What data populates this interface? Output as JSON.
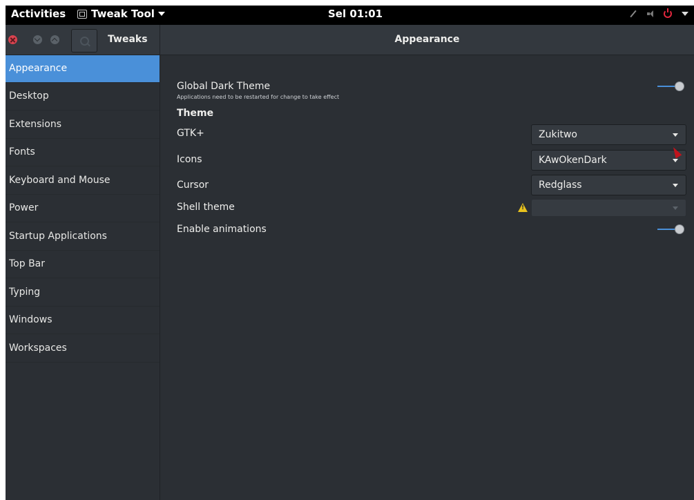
{
  "topbar": {
    "activities": "Activities",
    "app_menu": "Tweak Tool",
    "clock": "Sel 01:01"
  },
  "header": {
    "app_title": "Tweaks",
    "page_title": "Appearance"
  },
  "sidebar": {
    "items": [
      {
        "label": "Appearance"
      },
      {
        "label": "Desktop"
      },
      {
        "label": "Extensions"
      },
      {
        "label": "Fonts"
      },
      {
        "label": "Keyboard and Mouse"
      },
      {
        "label": "Power"
      },
      {
        "label": "Startup Applications"
      },
      {
        "label": "Top Bar"
      },
      {
        "label": "Typing"
      },
      {
        "label": "Windows"
      },
      {
        "label": "Workspaces"
      }
    ],
    "selected": "Appearance"
  },
  "appearance": {
    "global_dark_theme": {
      "label": "Global Dark Theme",
      "note": "Applications need to be restarted for change to take effect"
    },
    "theme_heading": "Theme",
    "gtk": {
      "label": "GTK+",
      "value": "Zukitwo"
    },
    "icons": {
      "label": "Icons",
      "value": "KAwOkenDark"
    },
    "cursor": {
      "label": "Cursor",
      "value": "Redglass"
    },
    "shell_theme": {
      "label": "Shell theme",
      "value": ""
    },
    "enable_animations": {
      "label": "Enable animations"
    }
  },
  "colors": {
    "accent": "#4a90d9",
    "background": "#2b2f34",
    "warning": "#e8c21d",
    "close_button": "#d9434f"
  },
  "icons": [
    "window-close-icon",
    "window-minimize-icon",
    "window-maximize-icon",
    "search-icon",
    "warning-icon",
    "power-icon",
    "volume-icon"
  ]
}
